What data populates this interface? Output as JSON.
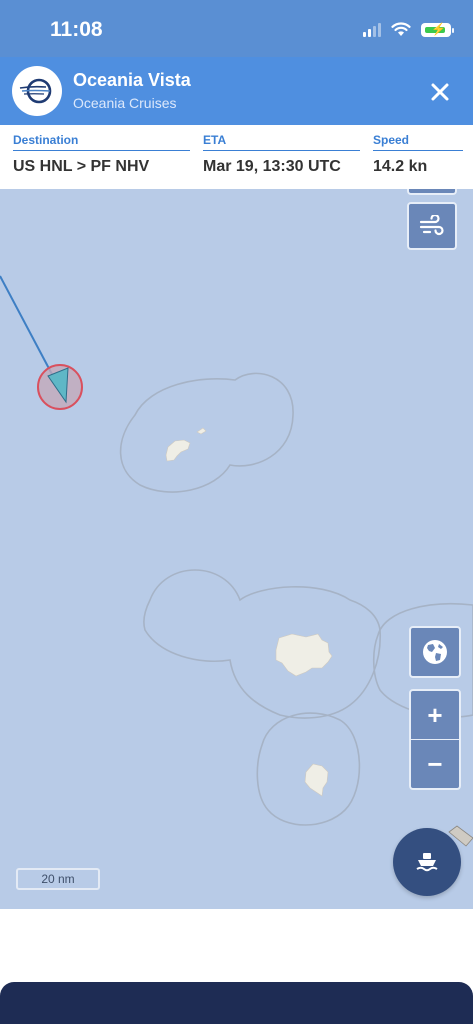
{
  "status_bar": {
    "time": "11:08",
    "icons": [
      "cellular-signal-icon",
      "wifi-icon",
      "battery-charging-icon"
    ]
  },
  "header": {
    "vessel_name": "Oceania Vista",
    "operator": "Oceania Cruises",
    "logo_icon": "oceania-logo-icon",
    "close_icon": "close-icon"
  },
  "info": {
    "destination_label": "Destination",
    "destination_value": "US HNL > PF NHV",
    "eta_label": "ETA",
    "eta_value": "Mar 19, 13:30 UTC",
    "speed_label": "Speed",
    "speed_value": "14.2 kn"
  },
  "map": {
    "scale_label": "20 nm",
    "controls": [
      "wind-layer-icon",
      "globe-icon",
      "zoom-in",
      "zoom-out",
      "fleet-ship-icon"
    ],
    "zoom_in_label": "+",
    "zoom_out_label": "−",
    "colors": {
      "sea": "#b8cbe7",
      "land": "#efeee6",
      "vessel": "#5fb7c6",
      "vessel_ring": "#d9505e",
      "button": "#6a87b8",
      "fleet_button": "#344f80"
    }
  }
}
